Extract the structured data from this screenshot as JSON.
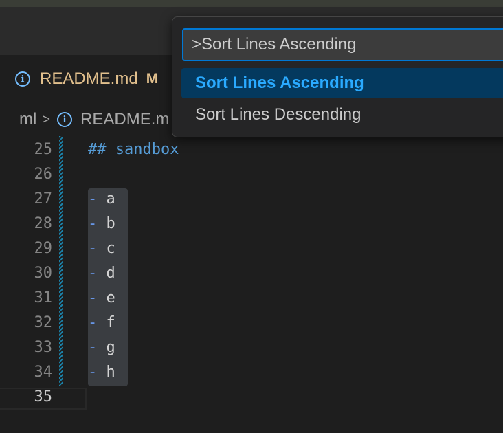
{
  "tab": {
    "icon": "info-icon",
    "filename": "README.md",
    "status": "M"
  },
  "breadcrumbs": {
    "folder": "ml",
    "separator": ">",
    "icon": "info-icon",
    "file": "README.m"
  },
  "editor": {
    "lines": [
      {
        "number": "25",
        "text": "## sandbox",
        "kind": "heading"
      },
      {
        "number": "26",
        "text": "",
        "kind": "blank"
      },
      {
        "number": "27",
        "bullet": "-",
        "text": "a",
        "kind": "item"
      },
      {
        "number": "28",
        "bullet": "-",
        "text": "b",
        "kind": "item"
      },
      {
        "number": "29",
        "bullet": "-",
        "text": "c",
        "kind": "item"
      },
      {
        "number": "30",
        "bullet": "-",
        "text": "d",
        "kind": "item"
      },
      {
        "number": "31",
        "bullet": "-",
        "text": "e",
        "kind": "item"
      },
      {
        "number": "32",
        "bullet": "-",
        "text": "f",
        "kind": "item"
      },
      {
        "number": "33",
        "bullet": "-",
        "text": "g",
        "kind": "item"
      },
      {
        "number": "34",
        "bullet": "-",
        "text": "h",
        "kind": "item"
      },
      {
        "number": "35",
        "text": "",
        "kind": "current"
      }
    ]
  },
  "command_palette": {
    "input_value": ">Sort Lines Ascending",
    "items": [
      {
        "label": "Sort Lines Ascending",
        "selected": true
      },
      {
        "label": "Sort Lines Descending",
        "selected": false
      }
    ]
  },
  "colors": {
    "accent": "#0078d4",
    "selection": "#04395e",
    "modified": "#e2c08d"
  }
}
